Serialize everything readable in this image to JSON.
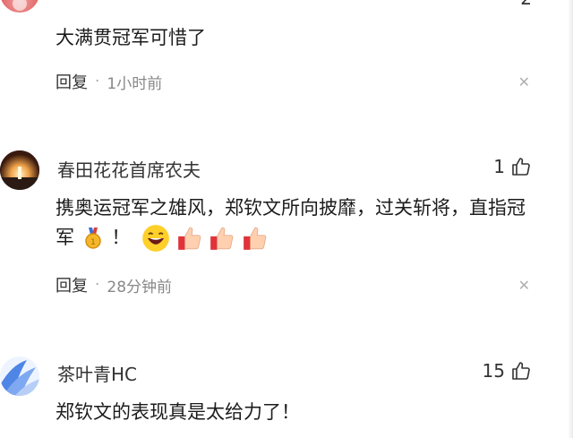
{
  "comments": [
    {
      "username": "",
      "like_count": "2",
      "text": "大满贯冠军可惜了",
      "reply_label": "回复",
      "time": "1小时前"
    },
    {
      "username": "春田花花首席农夫",
      "like_count": "1",
      "text": "携奥运冠军之雄风，郑钦文所向披靡，过关斩将，直指冠军",
      "text_end": "！",
      "emoji": [
        "gold-medal",
        "grinning-face",
        "thumbs-up",
        "thumbs-up",
        "thumbs-up"
      ],
      "reply_label": "回复",
      "time": "28分钟前"
    },
    {
      "username": "茶叶青HC",
      "like_count": "15",
      "text": "郑钦文的表现真是太给力了！"
    }
  ],
  "icons": {
    "like": "thumbs-up-outline-icon",
    "dismiss": "close-icon",
    "dot": "·"
  },
  "colors": {
    "reply": "#333333",
    "meta": "#888888",
    "text": "#1c1c1c"
  }
}
